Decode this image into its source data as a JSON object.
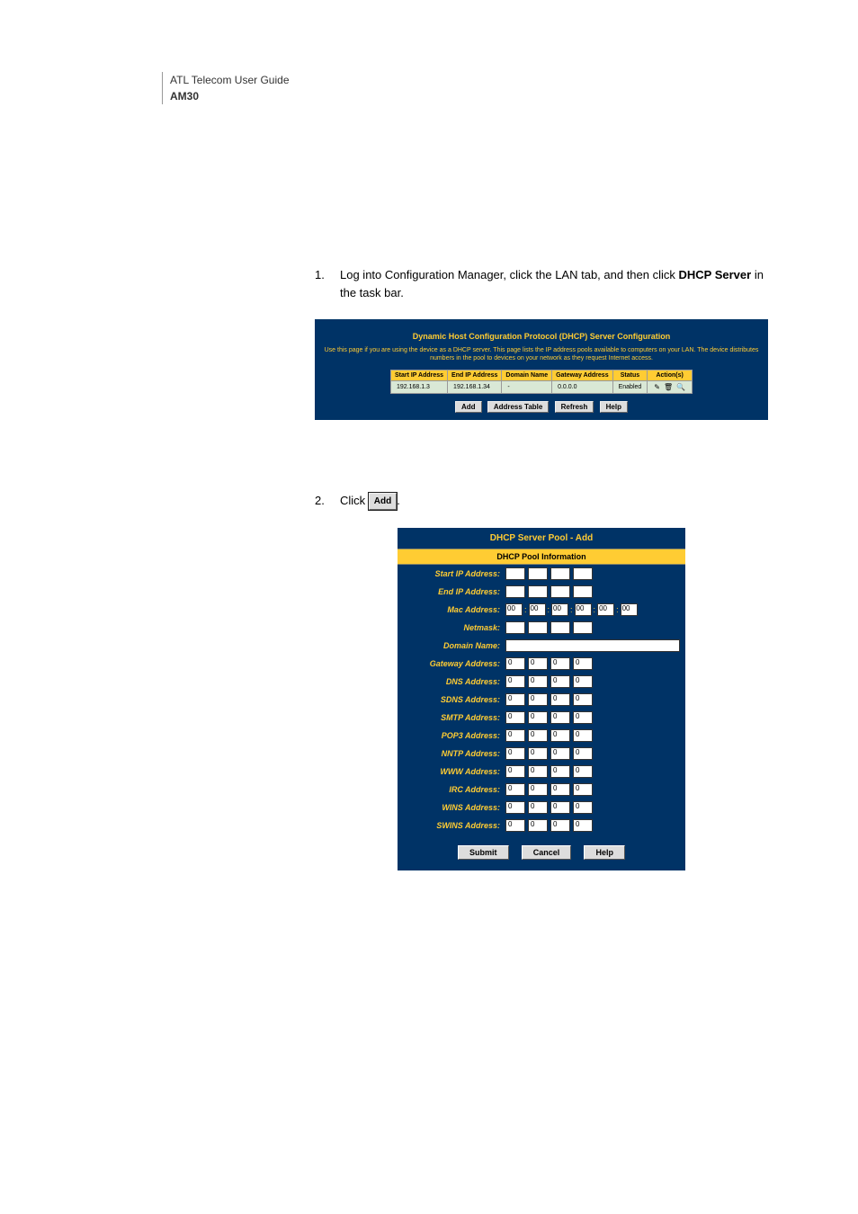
{
  "header": {
    "line1": "ATL Telecom User Guide",
    "model": "AM30"
  },
  "step1": {
    "num": "1.",
    "pre": "Log into Configuration Manager, click the LAN tab, and then click ",
    "bold": "DHCP Server",
    "post": " in the task bar."
  },
  "panel1": {
    "title": "Dynamic Host Configuration Protocol (DHCP) Server Configuration",
    "desc": "Use this page if you are using the device as a DHCP server. This page lists the IP address pools available to computers on your LAN. The device distributes numbers in the pool to devices on your network as they request Internet access.",
    "cols": [
      "Start IP Address",
      "End IP Address",
      "Domain Name",
      "Gateway Address",
      "Status",
      "Action(s)"
    ],
    "row": {
      "start": "192.168.1.3",
      "end": "192.168.1.34",
      "domain": "-",
      "gateway": "0.0.0.0",
      "status": "Enabled"
    },
    "buttons": [
      "Add",
      "Address Table",
      "Refresh",
      "Help"
    ]
  },
  "step2": {
    "num": "2.",
    "pre": "Click ",
    "add_label": "Add",
    "post": "."
  },
  "panel2": {
    "title": "DHCP Server Pool - Add",
    "subtitle": "DHCP Pool Information",
    "mac_default": "00",
    "zero": "0",
    "labels": {
      "start_ip": "Start IP Address:",
      "end_ip": "End IP Address:",
      "mac": "Mac Address:",
      "netmask": "Netmask:",
      "domain": "Domain Name:",
      "gateway": "Gateway Address:",
      "dns": "DNS Address:",
      "sdns": "SDNS Address:",
      "smtp": "SMTP Address:",
      "pop3": "POP3 Address:",
      "nntp": "NNTP Address:",
      "www": "WWW Address:",
      "irc": "IRC Address:",
      "wins": "WINS Address:",
      "swins": "SWINS Address:"
    },
    "buttons": {
      "submit": "Submit",
      "cancel": "Cancel",
      "help": "Help"
    }
  }
}
